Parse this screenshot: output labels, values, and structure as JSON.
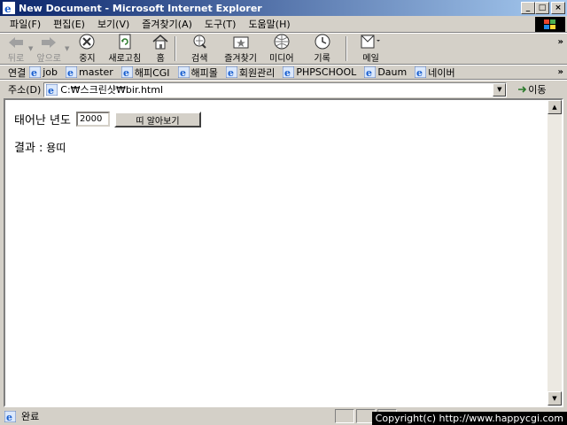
{
  "window": {
    "title": "New Document - Microsoft Internet Explorer",
    "minimize": "_",
    "maximize": "□",
    "close": "×"
  },
  "menu": [
    "파일(F)",
    "편집(E)",
    "보기(V)",
    "즐겨찾기(A)",
    "도구(T)",
    "도움말(H)"
  ],
  "toolbar": {
    "back": "뒤로",
    "forward": "앞으로",
    "stop": "중지",
    "refresh": "새로고침",
    "home": "홈",
    "search": "검색",
    "favorites": "즐겨찾기",
    "media": "미디어",
    "history": "기록",
    "mail": "메일",
    "overflow": "»"
  },
  "links": {
    "label": "연결",
    "items": [
      "job",
      "master",
      "해피CGI",
      "해피몰",
      "회원관리",
      "PHPSCHOOL",
      "Daum",
      "네이버"
    ],
    "overflow": "»"
  },
  "address": {
    "label": "주소(D)",
    "value": "C:₩스크린샷₩bir.html",
    "go": "이동"
  },
  "page": {
    "year_label": "태어난 년도",
    "year_value": "2000",
    "button": "띠 알아보기",
    "result_label": "결과 :",
    "result_value": "용띠"
  },
  "status": {
    "text": "완료",
    "copyright": "Copyright(c) http://www.happycgi.com"
  },
  "colors": {
    "title_start": "#0a246a",
    "title_end": "#a6caf0",
    "chrome": "#d4d0c8"
  }
}
